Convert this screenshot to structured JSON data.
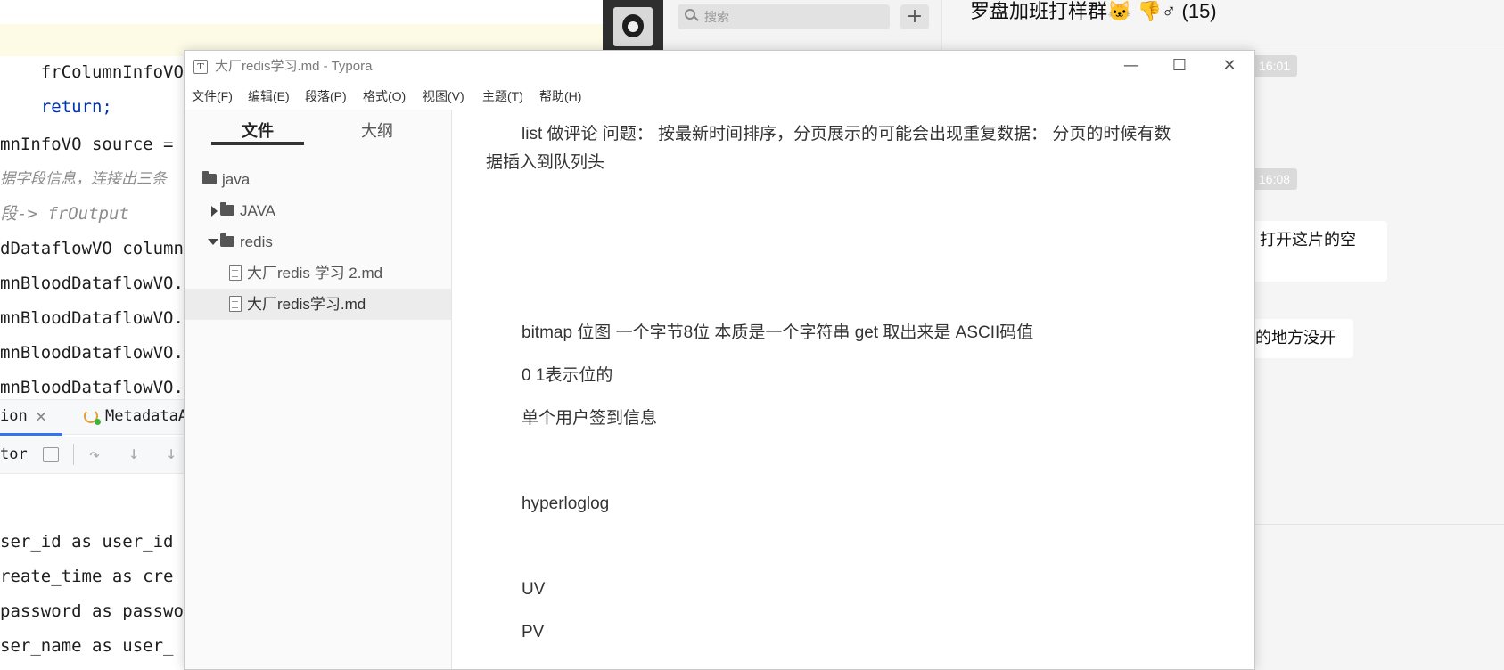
{
  "ide": {
    "code_lines": [
      {
        "text": "frColumnInfoVOMP.get(frKey) == null) {"
      },
      {
        "text": "return;"
      },
      {
        "text": ""
      },
      {
        "text": "mnInfoVO source ="
      },
      {
        "text": "据字段信息，连接出三条"
      },
      {
        "text": "段-> frOutput"
      },
      {
        "text": "dDataflowVO column"
      },
      {
        "text": "mnBloodDataflowVO."
      },
      {
        "text": "mnBloodDataflowVO."
      },
      {
        "text": "mnBloodDataflowVO."
      },
      {
        "text": "mnBloodDataflowVO."
      }
    ],
    "tabs": {
      "tab1": "ion",
      "tab1_close": "×",
      "tab2": "MetadataA"
    },
    "toolbar": {
      "label": "tor"
    },
    "sql_lines": [
      {
        "text": "ser_id as user_id"
      },
      {
        "text": "reate_time as cre"
      },
      {
        "text": "password as passwo"
      },
      {
        "text": "ser_name as user_"
      }
    ]
  },
  "chat": {
    "search_placeholder": "搜索",
    "add_label": "+",
    "group_title": "罗盘加班打样群🐱 👎♂ (15)",
    "time1": "16:01",
    "time2": "16:08",
    "bubble1": "]，打开这片的空",
    "bubble2": "来的地方没开"
  },
  "typora": {
    "window_title": "大厂redis学习.md - Typora",
    "app_icon": "T",
    "controls": {
      "minimize": "—",
      "maximize": "☐",
      "close": "✕"
    },
    "menu": [
      "文件(F)",
      "编辑(E)",
      "段落(P)",
      "格式(O)",
      "视图(V)",
      "主题(T)",
      "帮助(H)"
    ],
    "sidebar": {
      "tab_files": "文件",
      "tab_outline": "大纲",
      "tree": [
        {
          "label": "java",
          "kind": "folder"
        },
        {
          "label": "JAVA",
          "kind": "folder-collapsed"
        },
        {
          "label": "redis",
          "kind": "folder-expanded"
        },
        {
          "label": "大厂redis 学习 2.md",
          "kind": "file"
        },
        {
          "label": "大厂redis学习.md",
          "kind": "file-selected"
        }
      ]
    },
    "editor": {
      "p1": "list 做评论 问题： 按最新时间排序，分页展示的可能会出现重复数据： 分页的时候有数",
      "p1b": "据插入到队列头",
      "p2": "bitmap  位图 一个字节8位  本质是一个字符串 get 取出来是 ASCII码值",
      "p3": "0 1表示位的",
      "p4": "单个用户签到信息",
      "p5": "hyperloglog",
      "p6": "UV",
      "p7": "PV"
    }
  }
}
